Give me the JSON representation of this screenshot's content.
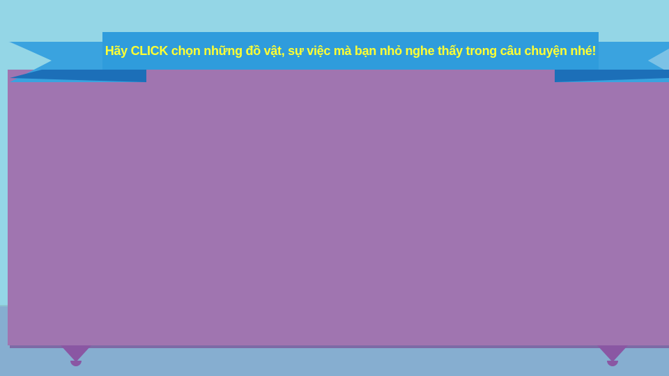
{
  "banner": {
    "instruction": "Hãy CLICK chọn những đồ vật, sự việc mà bạn nhỏ nghe thấy trong câu chuyện nhé!"
  },
  "colors": {
    "sky": "#94d6e6",
    "ground": "#86aed0",
    "ground_line": "#8bc4cf",
    "board": "#a075b0",
    "board_shadow": "#7d6aa6",
    "leg": "#8a57a3",
    "ribbon_main": "#2f9cdc",
    "ribbon_fold": "#1c6fb8",
    "ribbon_tail": "#3aa3df",
    "ribbon_tail_light": "#7cc2e6",
    "text": "#ffff33"
  }
}
